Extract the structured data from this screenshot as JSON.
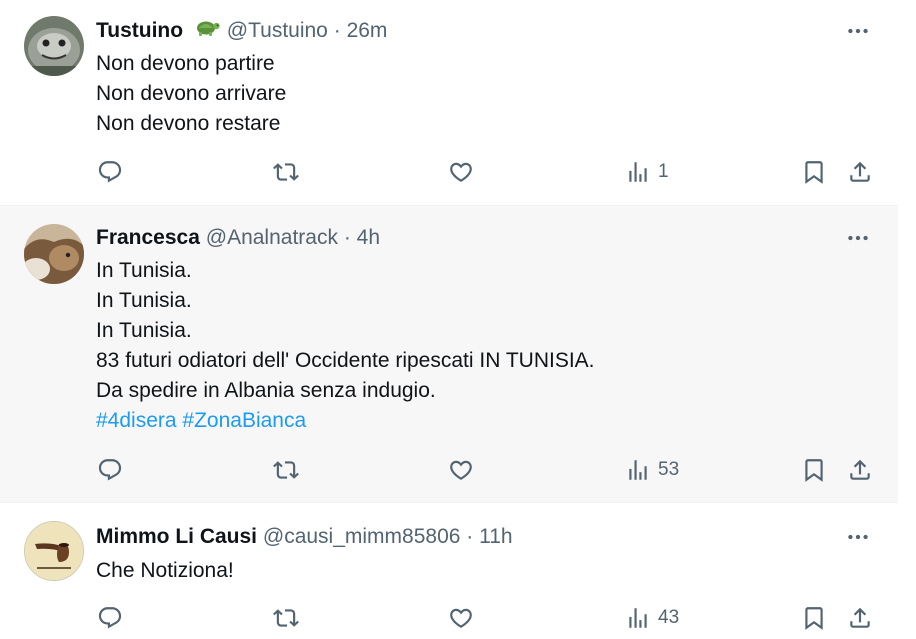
{
  "tweets": [
    {
      "name": "Tustuino",
      "handle": "@Tustuino",
      "sep": "·",
      "time": "26m",
      "lines": [
        "Non devono partire",
        "Non devono arrivare",
        "Non devono restare"
      ],
      "views": "1"
    },
    {
      "name": "Francesca",
      "handle": "@Analnatrack",
      "sep": "·",
      "time": "4h",
      "lines": [
        "In Tunisia.",
        "In Tunisia.",
        "In Tunisia.",
        "83 futuri odiatori dell' Occidente ripescati IN TUNISIA.",
        "Da spedire in Albania senza indugio."
      ],
      "hashtags": [
        "#4disera",
        "#ZonaBianca"
      ],
      "views": "53"
    },
    {
      "name": "Mimmo Li Causi",
      "handle": "@causi_mimm85806",
      "sep": "·",
      "time": "11h",
      "lines": [
        "Che Notiziona!"
      ],
      "views": "43"
    }
  ],
  "icons": {
    "more": "more-dots-icon",
    "reply": "reply-icon",
    "retweet": "retweet-icon",
    "like": "heart-icon",
    "views": "views-bar-chart-icon",
    "bookmark": "bookmark-icon",
    "share": "share-icon",
    "badge": "turtle-emoji-icon"
  },
  "colors": {
    "text": "#0f1419",
    "secondary": "#536471",
    "link": "#1d9bf0",
    "highlight_bg": "#f7f7f7"
  }
}
